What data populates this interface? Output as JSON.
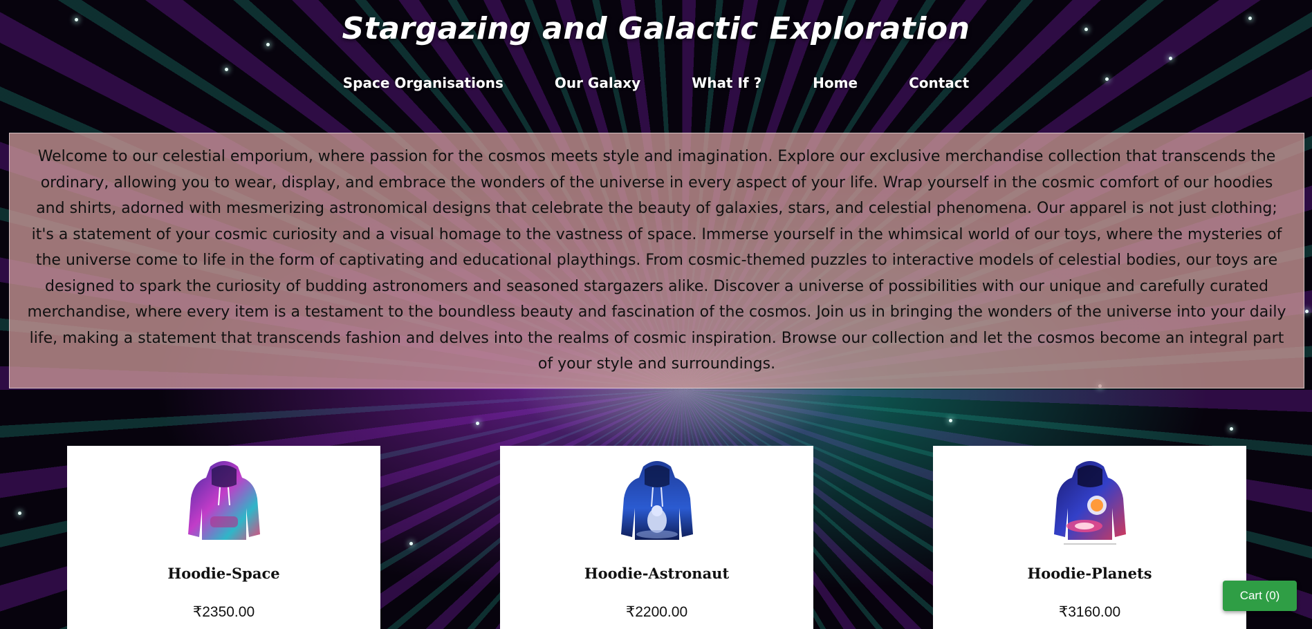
{
  "site": {
    "title": "Stargazing and Galactic Exploration"
  },
  "nav": {
    "items": [
      {
        "label": "Space Organisations"
      },
      {
        "label": "Our Galaxy"
      },
      {
        "label": "What If ?"
      },
      {
        "label": "Home"
      },
      {
        "label": "Contact"
      }
    ]
  },
  "intro": {
    "text": "Welcome to our celestial emporium, where passion for the cosmos meets style and imagination. Explore our exclusive merchandise collection that transcends the ordinary, allowing you to wear, display, and embrace the wonders of the universe in every aspect of your life. Wrap yourself in the cosmic comfort of our hoodies and shirts, adorned with mesmerizing astronomical designs that celebrate the beauty of galaxies, stars, and celestial phenomena. Our apparel is not just clothing; it's a statement of your cosmic curiosity and a visual homage to the vastness of space. Immerse yourself in the whimsical world of our toys, where the mysteries of the universe come to life in the form of captivating and educational playthings. From cosmic-themed puzzles to interactive models of celestial bodies, our toys are designed to spark the curiosity of budding astronomers and seasoned stargazers alike. Discover a universe of possibilities with our unique and carefully curated merchandise, where every item is a testament to the boundless beauty and fascination of the cosmos. Join us in bringing the wonders of the universe into your daily life, making a statement that transcends fashion and delves into the realms of cosmic inspiration. Browse our collection and let the cosmos become an integral part of your style and surroundings."
  },
  "products": [
    {
      "name": "Hoodie-Space",
      "price": "₹2350.00",
      "image_icon": "hoodie-galaxy-icon"
    },
    {
      "name": "Hoodie-Astronaut",
      "price": "₹2200.00",
      "image_icon": "hoodie-astronaut-icon"
    },
    {
      "name": "Hoodie-Planets",
      "price": "₹3160.00",
      "image_icon": "hoodie-planets-icon"
    }
  ],
  "cart": {
    "label": "Cart (0)"
  },
  "colors": {
    "cart_button": "#2f9e45",
    "intro_panel": "#c89696",
    "card_background": "#ffffff"
  }
}
